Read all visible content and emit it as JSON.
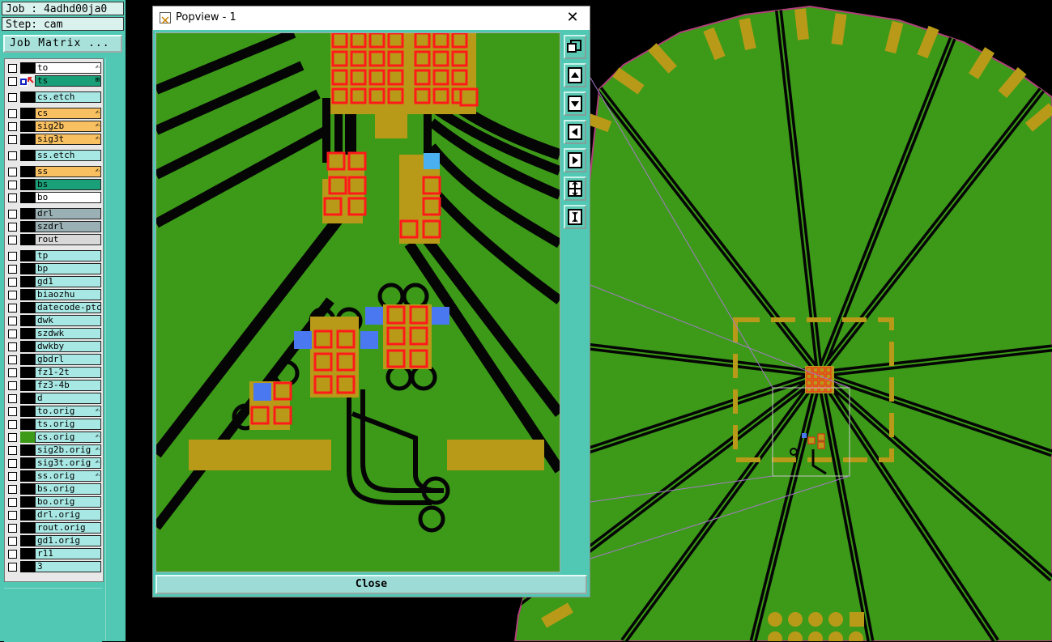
{
  "job": {
    "label": "Job : 4adhd00ja0"
  },
  "step": {
    "label": "Step: cam"
  },
  "job_matrix_button": "Job Matrix ...",
  "colors": {
    "board_green": "#3c9a18",
    "trace_black": "#050505",
    "pad_gold": "#b89a18",
    "pad_red": "#ff1a1a",
    "drill_blue": "#4a78f0",
    "panel_teal": "#50c8b4",
    "popview_outline": "#9a70b8"
  },
  "layers": [
    {
      "name": "to",
      "color": "#ffffff",
      "flag": "✍"
    },
    {
      "name": "ts",
      "color": "#1aa078",
      "flag": "⊞",
      "active": true
    },
    {
      "name": "cs.etch",
      "color": "#a8e8e4"
    },
    {
      "name": "cs",
      "color": "#f8c060",
      "flag": "✍"
    },
    {
      "name": "sig2b",
      "color": "#f8c060",
      "flag": "✍"
    },
    {
      "name": "sig3t",
      "color": "#f8c060",
      "flag": "✍"
    },
    {
      "name": "ss.etch",
      "color": "#a8e8e4"
    },
    {
      "name": "ss",
      "color": "#f8c060",
      "flag": "✍"
    },
    {
      "name": "bs",
      "color": "#1aa078"
    },
    {
      "name": "bo",
      "color": "#ffffff"
    },
    {
      "name": "drl",
      "color": "#9ab0b4"
    },
    {
      "name": "szdrl",
      "color": "#9ab0b4"
    },
    {
      "name": "rout",
      "color": "#d8d8d8"
    },
    {
      "name": "tp",
      "color": "#a8e8e4"
    },
    {
      "name": "bp",
      "color": "#a8e8e4"
    },
    {
      "name": "gd1",
      "color": "#a8e8e4"
    },
    {
      "name": "biaozhu",
      "color": "#a8e8e4"
    },
    {
      "name": "datecode-ptc",
      "color": "#a8e8e4"
    },
    {
      "name": "dwk",
      "color": "#a8e8e4"
    },
    {
      "name": "szdwk",
      "color": "#a8e8e4"
    },
    {
      "name": "dwkby",
      "color": "#a8e8e4"
    },
    {
      "name": "gbdrl",
      "color": "#a8e8e4"
    },
    {
      "name": "fz1-2t",
      "color": "#a8e8e4"
    },
    {
      "name": "fz3-4b",
      "color": "#a8e8e4"
    },
    {
      "name": "d",
      "color": "#a8e8e4"
    },
    {
      "name": "to.orig",
      "color": "#a8e8e4",
      "flag": "✍"
    },
    {
      "name": "ts.orig",
      "color": "#a8e8e4"
    },
    {
      "name": "cs.orig",
      "color": "#a8e8e4",
      "flag": "✍",
      "marker": "#3c9a18"
    },
    {
      "name": "sig2b.orig",
      "color": "#a8e8e4",
      "flag": "✍"
    },
    {
      "name": "sig3t.orig",
      "color": "#a8e8e4",
      "flag": "✍"
    },
    {
      "name": "ss.orig",
      "color": "#a8e8e4",
      "flag": "✍"
    },
    {
      "name": "bs.orig",
      "color": "#a8e8e4"
    },
    {
      "name": "bo.orig",
      "color": "#a8e8e4"
    },
    {
      "name": "drl.orig",
      "color": "#a8e8e4"
    },
    {
      "name": "rout.orig",
      "color": "#a8e8e4"
    },
    {
      "name": "gd1.orig",
      "color": "#a8e8e4"
    },
    {
      "name": "r11",
      "color": "#a8e8e4"
    },
    {
      "name": "3",
      "color": "#a8e8e4"
    }
  ],
  "popview": {
    "title": "Popview - 1",
    "close_label": "Close",
    "tools": [
      "zoom-fit-icon",
      "pan-up-icon",
      "pan-down-icon",
      "pan-left-icon",
      "pan-right-icon",
      "zoom-in-icon",
      "zoom-out-icon"
    ]
  }
}
